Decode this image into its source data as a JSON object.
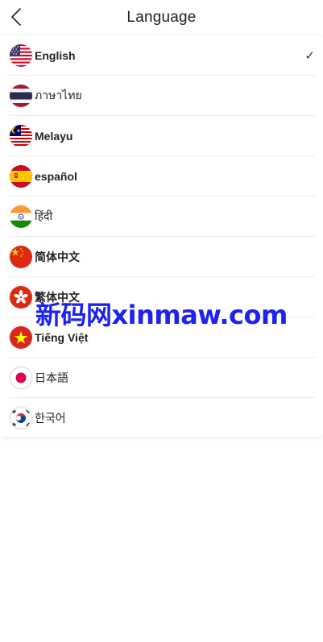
{
  "header": {
    "title": "Language",
    "back_icon": "chevron-left-icon"
  },
  "languages": [
    {
      "label": "English",
      "flag": "us-flag-icon",
      "selected": true
    },
    {
      "label": "ภาษาไทย",
      "flag": "thailand-flag-icon",
      "selected": false
    },
    {
      "label": "Melayu",
      "flag": "malaysia-flag-icon",
      "selected": false
    },
    {
      "label": "español",
      "flag": "spain-flag-icon",
      "selected": false
    },
    {
      "label": "हिंदी",
      "flag": "india-flag-icon",
      "selected": false
    },
    {
      "label": "简体中文",
      "flag": "china-flag-icon",
      "selected": false
    },
    {
      "label": "繁体中文",
      "flag": "hong-kong-flag-icon",
      "selected": false
    },
    {
      "label": "Tiếng Việt",
      "flag": "vietnam-flag-icon",
      "selected": false
    },
    {
      "label": "日本語",
      "flag": "japan-flag-icon",
      "selected": false
    },
    {
      "label": "한국어",
      "flag": "korea-flag-icon",
      "selected": false
    }
  ],
  "check_mark": "✓",
  "watermark": "新码网xinmaw.com",
  "colors": {
    "watermark": "#1e22f0",
    "divider": "#ececec"
  }
}
